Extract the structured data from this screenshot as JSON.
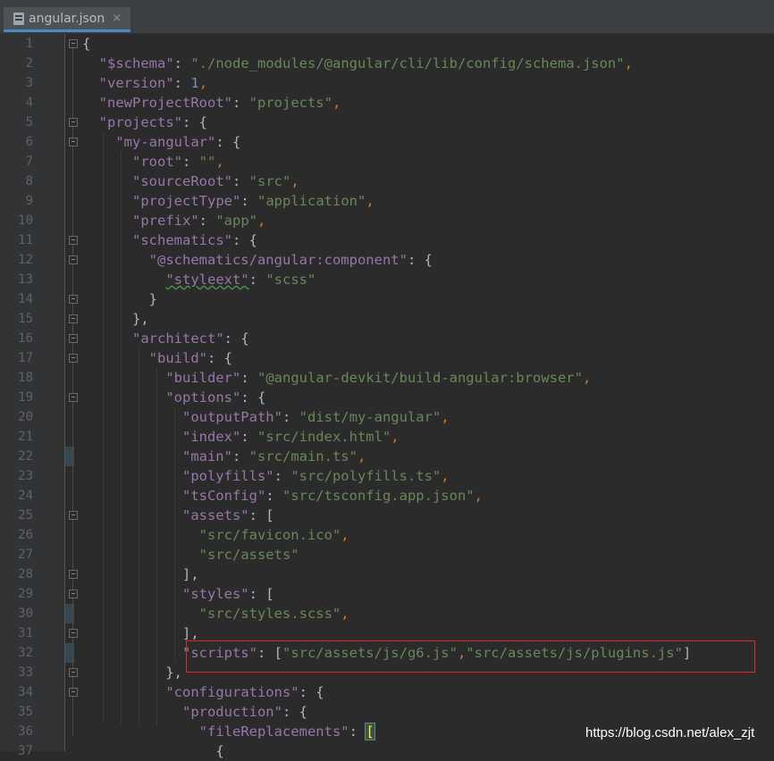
{
  "tab": {
    "label": "angular.json",
    "close": "×"
  },
  "line_numbers": [
    "1",
    "2",
    "3",
    "4",
    "5",
    "6",
    "7",
    "8",
    "9",
    "10",
    "11",
    "12",
    "13",
    "14",
    "15",
    "16",
    "17",
    "18",
    "19",
    "20",
    "21",
    "22",
    "23",
    "24",
    "25",
    "26",
    "27",
    "28",
    "29",
    "30",
    "31",
    "32",
    "33",
    "34",
    "35",
    "36",
    "37"
  ],
  "code": {
    "l1": "{",
    "l2k": "\"$schema\"",
    "l2v": "\"./node_modules/@angular/cli/lib/config/schema.json\"",
    "l3k": "\"version\"",
    "l3v": "1",
    "l4k": "\"newProjectRoot\"",
    "l4v": "\"projects\"",
    "l5k": "\"projects\"",
    "l6k": "\"my-angular\"",
    "l7k": "\"root\"",
    "l7v": "\"\"",
    "l8k": "\"sourceRoot\"",
    "l8v": "\"src\"",
    "l9k": "\"projectType\"",
    "l9v": "\"application\"",
    "l10k": "\"prefix\"",
    "l10v": "\"app\"",
    "l11k": "\"schematics\"",
    "l12k": "\"@schematics/angular:component\"",
    "l13k": "\"styleext\"",
    "l13v": "\"scss\"",
    "l14": "}",
    "l15": "},",
    "l16k": "\"architect\"",
    "l17k": "\"build\"",
    "l18k": "\"builder\"",
    "l18v": "\"@angular-devkit/build-angular:browser\"",
    "l19k": "\"options\"",
    "l20k": "\"outputPath\"",
    "l20v": "\"dist/my-angular\"",
    "l21k": "\"index\"",
    "l21v": "\"src/index.html\"",
    "l22k": "\"main\"",
    "l22v": "\"src/main.ts\"",
    "l23k": "\"polyfills\"",
    "l23v": "\"src/polyfills.ts\"",
    "l24k": "\"tsConfig\"",
    "l24v": "\"src/tsconfig.app.json\"",
    "l25k": "\"assets\"",
    "l26v": "\"src/favicon.ico\"",
    "l27v": "\"src/assets\"",
    "l28": "],",
    "l29k": "\"styles\"",
    "l30v": "\"src/styles.scss\"",
    "l31": "],",
    "l32k": "\"scripts\"",
    "l32v1": "\"src/assets/js/g6.js\"",
    "l32v2": "\"src/assets/js/plugins.js\"",
    "l33": "},",
    "l34k": "\"configurations\"",
    "l35k": "\"production\"",
    "l36k": "\"fileReplacements\"",
    "l37": "{"
  },
  "watermark": "https://blog.csdn.net/alex_zjt"
}
